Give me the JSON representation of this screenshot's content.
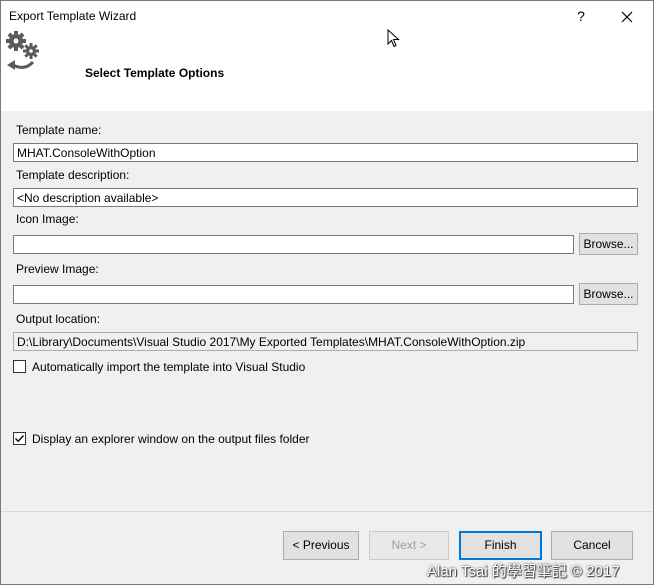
{
  "window": {
    "title": "Export Template Wizard",
    "help_label": "?",
    "close_label": "✕"
  },
  "header": {
    "title": "Select Template Options",
    "icon": "export-template-gears-icon"
  },
  "form": {
    "template_name_label": "Template name:",
    "template_name_value": "MHAT.ConsoleWithOption",
    "template_description_label": "Template description:",
    "template_description_value": "<No description available>",
    "icon_image_label": "Icon Image:",
    "icon_image_value": "",
    "icon_browse_label": "Browse...",
    "preview_image_label": "Preview Image:",
    "preview_image_value": "",
    "preview_browse_label": "Browse...",
    "output_location_label": "Output location:",
    "output_location_value": "D:\\Library\\Documents\\Visual Studio 2017\\My Exported Templates\\MHAT.ConsoleWithOption.zip",
    "auto_import_label": "Automatically import the template into Visual Studio",
    "auto_import_checked": false,
    "display_explorer_label": "Display an explorer window on the output files folder",
    "display_explorer_checked": true
  },
  "footer": {
    "previous_label": "< Previous",
    "next_label": "Next >",
    "finish_label": "Finish",
    "cancel_label": "Cancel"
  },
  "watermark": "Alan Tsai 的學習筆記 © 2017",
  "colors": {
    "dialog_bg": "#f0f0f0",
    "header_bg": "#ffffff",
    "default_button_border": "#0078d7",
    "disabled_text": "#a0a0a0"
  }
}
